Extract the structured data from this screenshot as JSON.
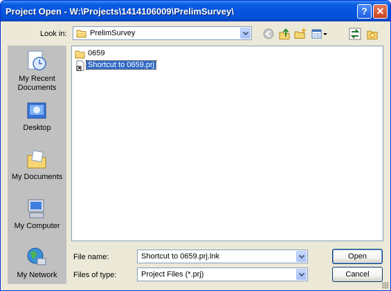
{
  "window": {
    "title": "Project Open - W:\\Projects\\1414106009\\PrelimSurvey\\",
    "help_glyph": "?",
    "close_glyph": "✕"
  },
  "look_in": {
    "label": "Look in:",
    "value": "PrelimSurvey"
  },
  "toolbar": {
    "icons": [
      "back-icon",
      "up-folder-icon",
      "new-folder-icon",
      "views-menu-icon",
      "refresh-icon",
      "new-item-icon"
    ]
  },
  "places": [
    {
      "label": "My Recent Documents",
      "icon": "recent-documents-icon"
    },
    {
      "label": "Desktop",
      "icon": "desktop-icon"
    },
    {
      "label": "My Documents",
      "icon": "my-documents-icon"
    },
    {
      "label": "My Computer",
      "icon": "my-computer-icon"
    },
    {
      "label": "My Network",
      "icon": "my-network-icon"
    }
  ],
  "files": [
    {
      "name": "0659",
      "icon": "folder-icon",
      "selected": false
    },
    {
      "name": "Shortcut to 0659.prj",
      "icon": "shortcut-file-icon",
      "selected": true
    }
  ],
  "file_name": {
    "label": "File name:",
    "value": "Shortcut to 0659.prj.lnk"
  },
  "file_type": {
    "label": "Files of type:",
    "value": "Project Files (*.prj)"
  },
  "buttons": {
    "open": "Open",
    "cancel": "Cancel"
  }
}
